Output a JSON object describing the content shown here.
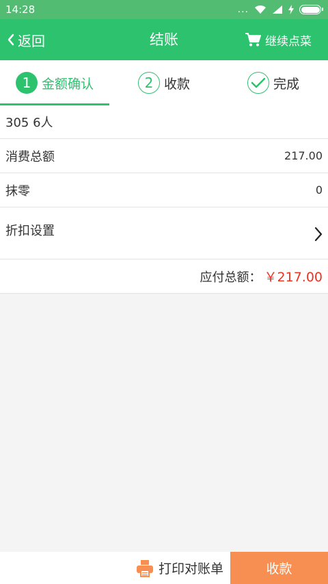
{
  "status_bar": {
    "time": "14:28",
    "dots": "..."
  },
  "app_bar": {
    "back_label": "返回",
    "title": "结账",
    "continue_label": "继续点菜"
  },
  "steps": [
    {
      "num": "1",
      "label": "金额确认"
    },
    {
      "num": "2",
      "label": "收款"
    },
    {
      "label": "完成"
    }
  ],
  "order": {
    "table_info": "305 6人",
    "total_label": "消费总额",
    "total_value": "217.00",
    "rounding_label": "抹零",
    "rounding_value": "0",
    "discount_label": "折扣设置",
    "due_label": "应付总额：",
    "due_value": "￥217.00"
  },
  "bottom": {
    "print_label": "打印对账单",
    "pay_label": "收款"
  },
  "colors": {
    "primary": "#2dc26e",
    "status_bar": "#52bd72",
    "accent": "#f88f52",
    "amount_red": "#ee3322"
  }
}
